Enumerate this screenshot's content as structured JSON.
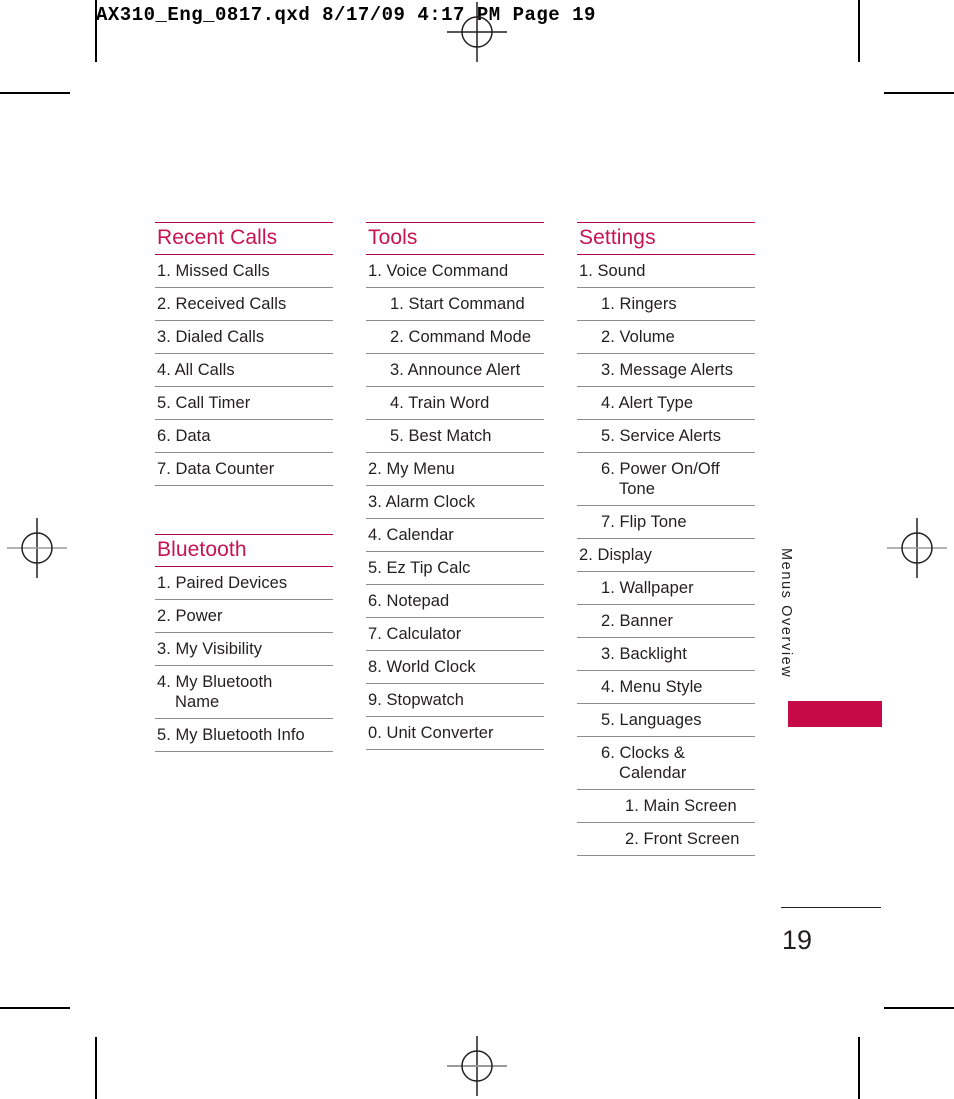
{
  "print_header": "AX310_Eng_0817.qxd  8/17/09  4:17 PM  Page 19",
  "side_tab": {
    "label": "Menus Overview",
    "accent_color": "#c50a47"
  },
  "folio": {
    "page_number": "19"
  },
  "theme": {
    "heading_color": "#c8134f",
    "rule_color": "#b0005a",
    "item_rule_color": "#8d8d8d",
    "text_color": "#231f20"
  },
  "columns": [
    {
      "sections": [
        {
          "title": "Recent Calls",
          "items": [
            {
              "text": "1. Missed Calls",
              "level": 1
            },
            {
              "text": "2. Received Calls",
              "level": 1
            },
            {
              "text": "3. Dialed Calls",
              "level": 1
            },
            {
              "text": "4. All Calls",
              "level": 1
            },
            {
              "text": "5. Call Timer",
              "level": 1
            },
            {
              "text": "6. Data",
              "level": 1
            },
            {
              "text": "7. Data Counter",
              "level": 1
            }
          ]
        },
        {
          "title": "Bluetooth",
          "items": [
            {
              "text": "1. Paired Devices",
              "level": 1
            },
            {
              "text": "2. Power",
              "level": 1
            },
            {
              "text": "3. My Visibility",
              "level": 1
            },
            {
              "text": "4. My Bluetooth",
              "level": 1,
              "wrap": "Name"
            },
            {
              "text": "5. My Bluetooth Info",
              "level": 1
            }
          ]
        }
      ]
    },
    {
      "sections": [
        {
          "title": "Tools",
          "items": [
            {
              "text": "1. Voice Command",
              "level": 1
            },
            {
              "text": "1. Start Command",
              "level": 2
            },
            {
              "text": "2. Command Mode",
              "level": 2
            },
            {
              "text": "3. Announce Alert",
              "level": 2
            },
            {
              "text": "4. Train Word",
              "level": 2
            },
            {
              "text": "5. Best Match",
              "level": 2
            },
            {
              "text": "2. My Menu",
              "level": 1
            },
            {
              "text": "3. Alarm Clock",
              "level": 1
            },
            {
              "text": "4. Calendar",
              "level": 1
            },
            {
              "text": "5. Ez Tip Calc",
              "level": 1
            },
            {
              "text": "6. Notepad",
              "level": 1
            },
            {
              "text": "7. Calculator",
              "level": 1
            },
            {
              "text": "8. World Clock",
              "level": 1
            },
            {
              "text": "9. Stopwatch",
              "level": 1
            },
            {
              "text": "0. Unit Converter",
              "level": 1
            }
          ]
        }
      ]
    },
    {
      "sections": [
        {
          "title": "Settings",
          "items": [
            {
              "text": "1. Sound",
              "level": 1
            },
            {
              "text": "1. Ringers",
              "level": 2
            },
            {
              "text": "2. Volume",
              "level": 2
            },
            {
              "text": "3. Message Alerts",
              "level": 2
            },
            {
              "text": "4. Alert Type",
              "level": 2
            },
            {
              "text": "5. Service Alerts",
              "level": 2
            },
            {
              "text": "6. Power On/Off",
              "level": 2,
              "wrap": "Tone"
            },
            {
              "text": "7. Flip Tone",
              "level": 2
            },
            {
              "text": "2. Display",
              "level": 1
            },
            {
              "text": "1. Wallpaper",
              "level": 2
            },
            {
              "text": "2. Banner",
              "level": 2
            },
            {
              "text": "3. Backlight",
              "level": 2
            },
            {
              "text": "4. Menu Style",
              "level": 2
            },
            {
              "text": "5. Languages",
              "level": 2
            },
            {
              "text": "6. Clocks &",
              "level": 2,
              "wrap": "Calendar"
            },
            {
              "text": "1. Main Screen",
              "level": 3
            },
            {
              "text": "2. Front Screen",
              "level": 3
            }
          ]
        }
      ]
    }
  ]
}
